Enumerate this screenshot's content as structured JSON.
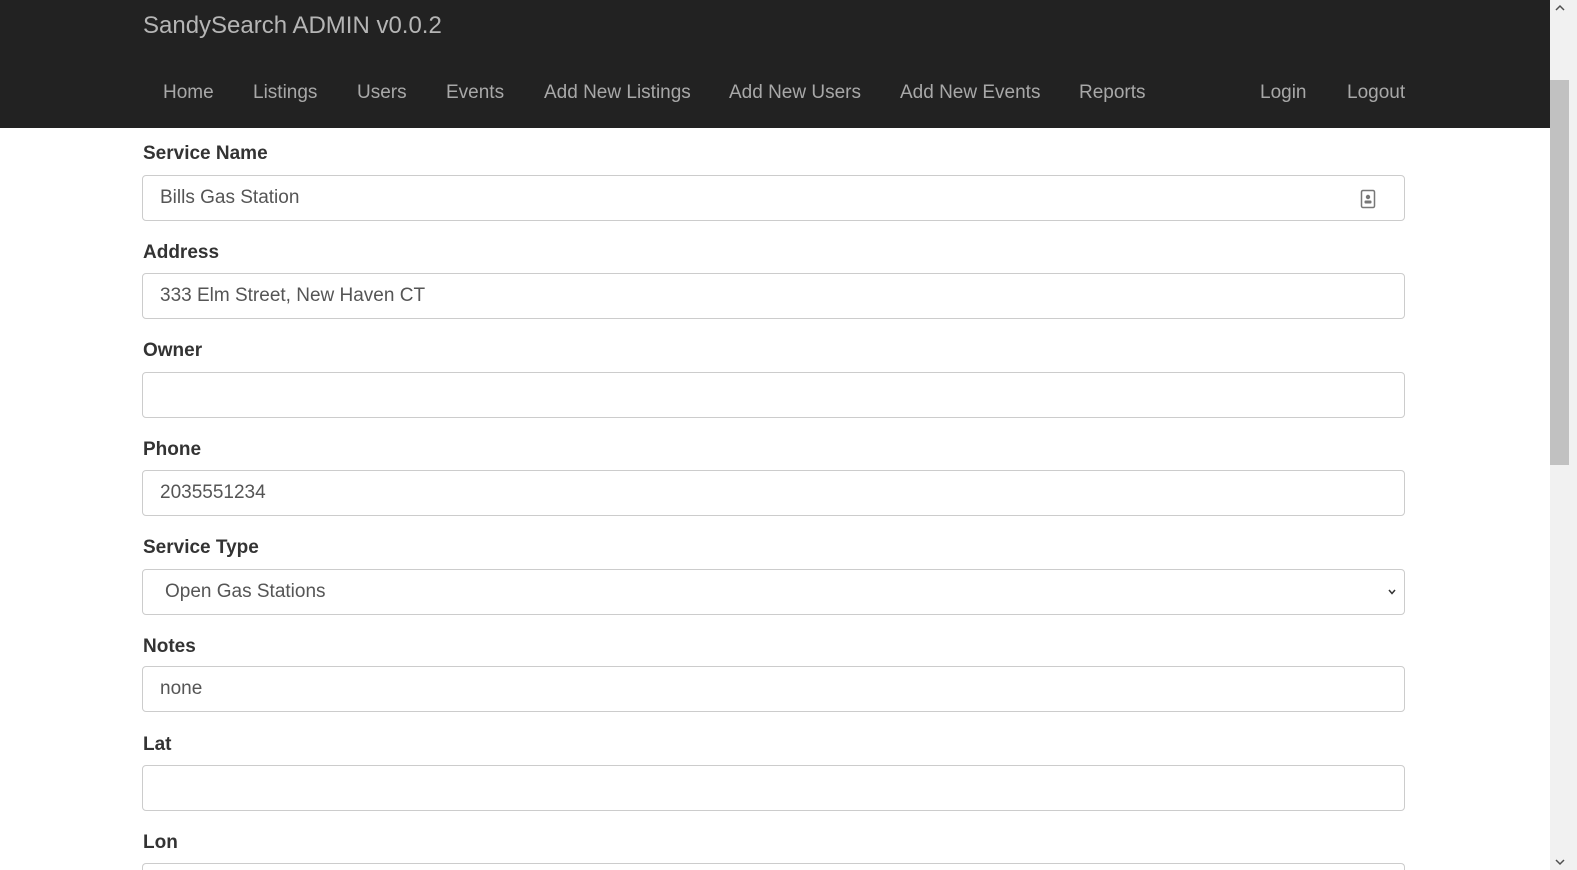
{
  "navbar": {
    "brand": "SandySearch ADMIN v0.0.2",
    "items": [
      {
        "label": "Home"
      },
      {
        "label": "Listings"
      },
      {
        "label": "Users"
      },
      {
        "label": "Events"
      },
      {
        "label": "Add New Listings"
      },
      {
        "label": "Add New Users"
      },
      {
        "label": "Add New Events"
      },
      {
        "label": "Reports"
      }
    ],
    "right_items": [
      {
        "label": "Login"
      },
      {
        "label": "Logout"
      }
    ],
    "background": "#222222",
    "link_color": "#a8a8a8"
  },
  "form": {
    "service_name": {
      "label": "Service Name",
      "value": "Bills Gas Station",
      "icon": "contact-card-icon"
    },
    "address": {
      "label": "Address",
      "value": "333 Elm Street, New Haven CT"
    },
    "owner": {
      "label": "Owner",
      "value": ""
    },
    "phone": {
      "label": "Phone",
      "value": "2035551234"
    },
    "service_type": {
      "label": "Service Type",
      "value": "Open Gas Stations"
    },
    "notes": {
      "label": "Notes",
      "value": "none"
    },
    "lat": {
      "label": "Lat",
      "value": ""
    },
    "lon": {
      "label": "Lon"
    }
  }
}
